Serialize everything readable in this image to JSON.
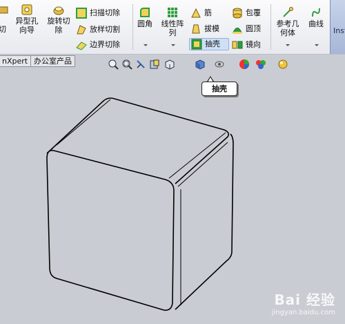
{
  "ribbon": {
    "cut_partial": "切",
    "hole_wizard": [
      "异型孔",
      "向导"
    ],
    "revolve_cut": [
      "旋转切",
      "除"
    ],
    "sweep_cut": "扫描切除",
    "loft_cut": "放样切割",
    "boundary_cut": "边界切除",
    "fillet": "圆角",
    "linear_pattern": [
      "线性阵",
      "列"
    ],
    "rib": "筋",
    "draft": "拔模",
    "shell": "抽壳",
    "wrap": "包覆",
    "dome": "圆顶",
    "mirror": "镜向",
    "ref_geometry": [
      "参考几",
      "何体"
    ],
    "curves": "曲线",
    "instant3d": "Inst"
  },
  "tabs": {
    "dimxpert": "nXpert",
    "office": "办公室产品"
  },
  "tooltip": "抽壳",
  "watermark": {
    "brand": "Bai 经验",
    "url": "jingyan.baidu.com"
  },
  "colors": {
    "accent": "#2f9e3f",
    "ribbon_bg": "#eef0f4",
    "viewport_bg": "#c9ccd2",
    "selected": "#cfe0f6"
  }
}
